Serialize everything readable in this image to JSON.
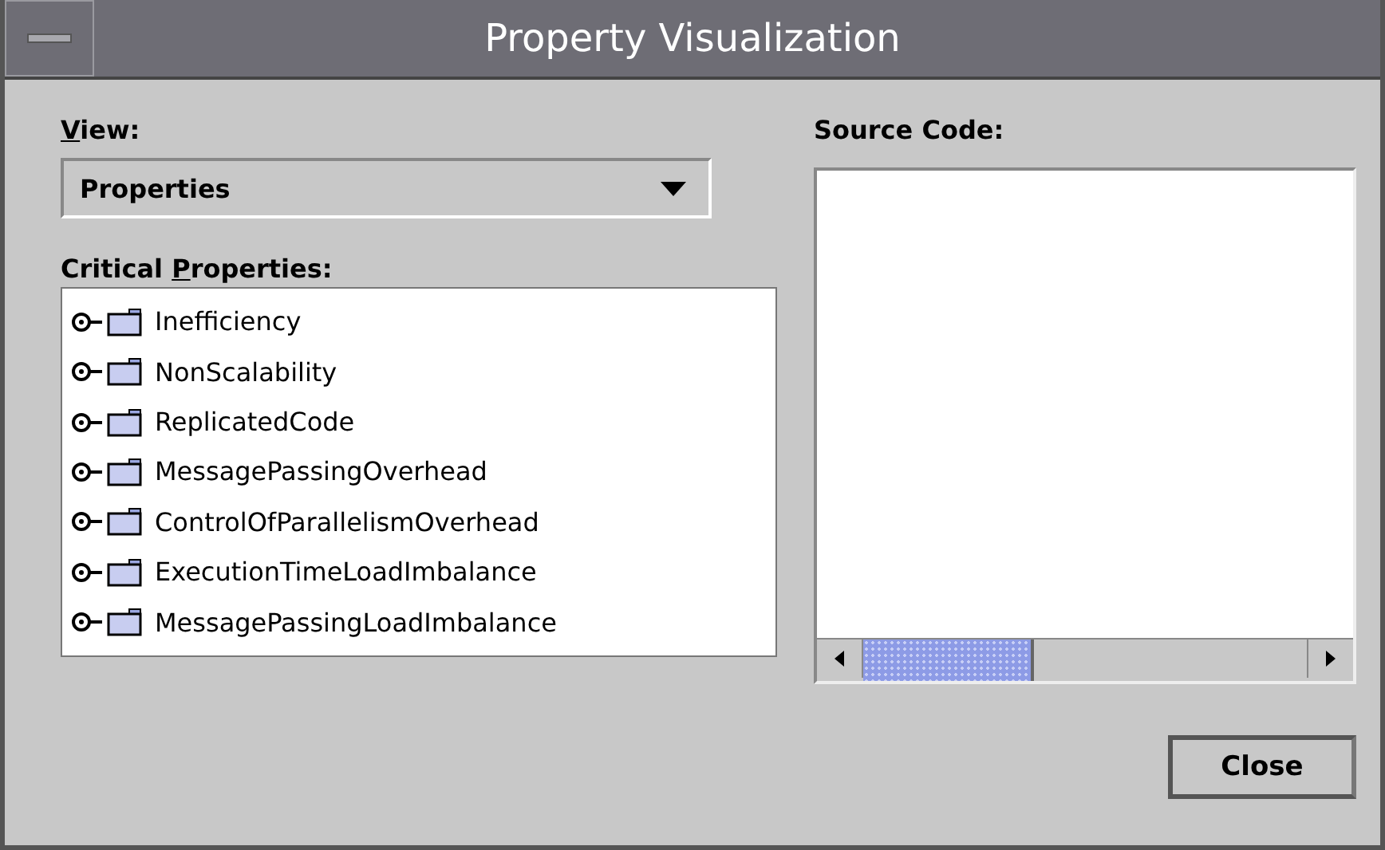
{
  "window": {
    "title": "Property Visualization"
  },
  "view": {
    "label": {
      "mnemonic": "V",
      "after": "iew:"
    },
    "value": "Properties"
  },
  "critical_properties": {
    "label": {
      "before": "Critical ",
      "mnemonic": "P",
      "after": "roperties:"
    },
    "items": [
      {
        "label": "Inefficiency",
        "expanded": false
      },
      {
        "label": "NonScalability",
        "expanded": false
      },
      {
        "label": "ReplicatedCode",
        "expanded": false
      },
      {
        "label": "MessagePassingOverhead",
        "expanded": false
      },
      {
        "label": "ControlOfParallelismOverhead",
        "expanded": false
      },
      {
        "label": "ExecutionTimeLoadImbalance",
        "expanded": false
      },
      {
        "label": "MessagePassingLoadImbalance",
        "expanded": false
      }
    ]
  },
  "source_code": {
    "label": "Source Code:"
  },
  "buttons": [
    {
      "label": "Close"
    }
  ]
}
